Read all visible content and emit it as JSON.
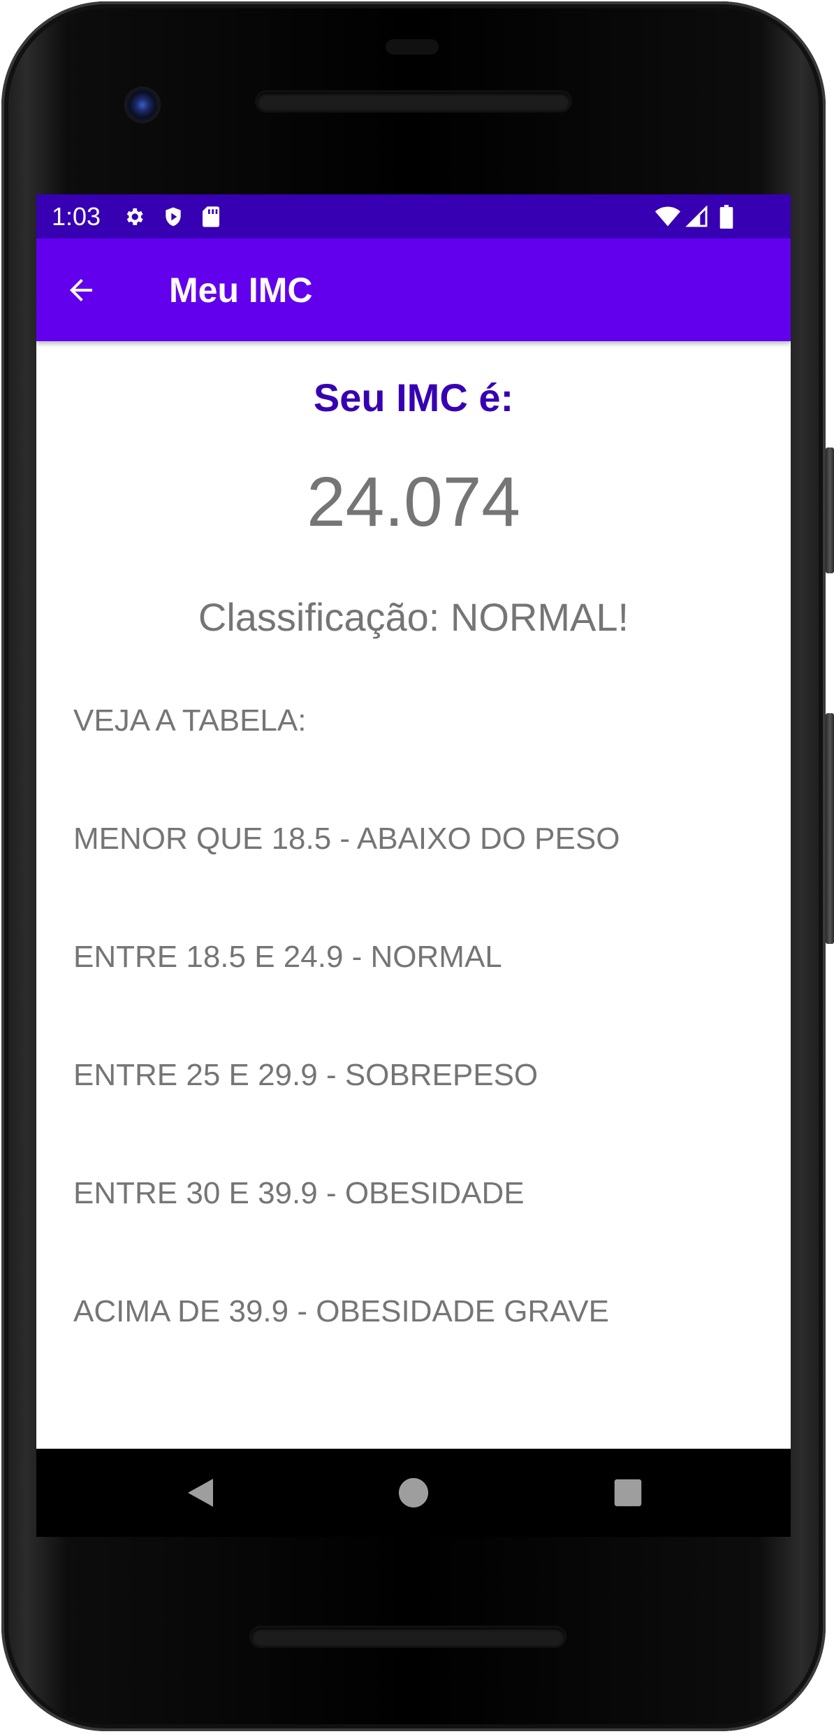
{
  "status_bar": {
    "time": "1:03",
    "left_icons": [
      "gear-icon",
      "shield-play-icon",
      "sd-card-icon"
    ],
    "right_icons": [
      "wifi-icon",
      "cell-signal-icon",
      "battery-icon"
    ],
    "background_color": "#3700b3"
  },
  "app_bar": {
    "title": "Meu IMC",
    "back_icon": "arrow-back-icon",
    "background_color": "#6200ee"
  },
  "result": {
    "heading": "Seu IMC é:",
    "value": "24.074",
    "classification": "Classificação: NORMAL!"
  },
  "table": {
    "title": "VEJA A TABELA:",
    "rows": [
      "MENOR QUE 18.5 - ABAIXO DO PESO",
      "ENTRE 18.5 E 24.9 - NORMAL",
      "ENTRE 25 E 29.9 - SOBREPESO",
      "ENTRE 30 E 39.9 - OBESIDADE",
      "ACIMA DE 39.9 - OBESIDADE GRAVE"
    ]
  },
  "nav_bar": {
    "buttons": [
      "back-triangle-icon",
      "home-circle-icon",
      "recents-square-icon"
    ]
  },
  "colors": {
    "accent": "#6200ee",
    "accent_dark": "#3700b3",
    "text_gray": "#757575"
  }
}
